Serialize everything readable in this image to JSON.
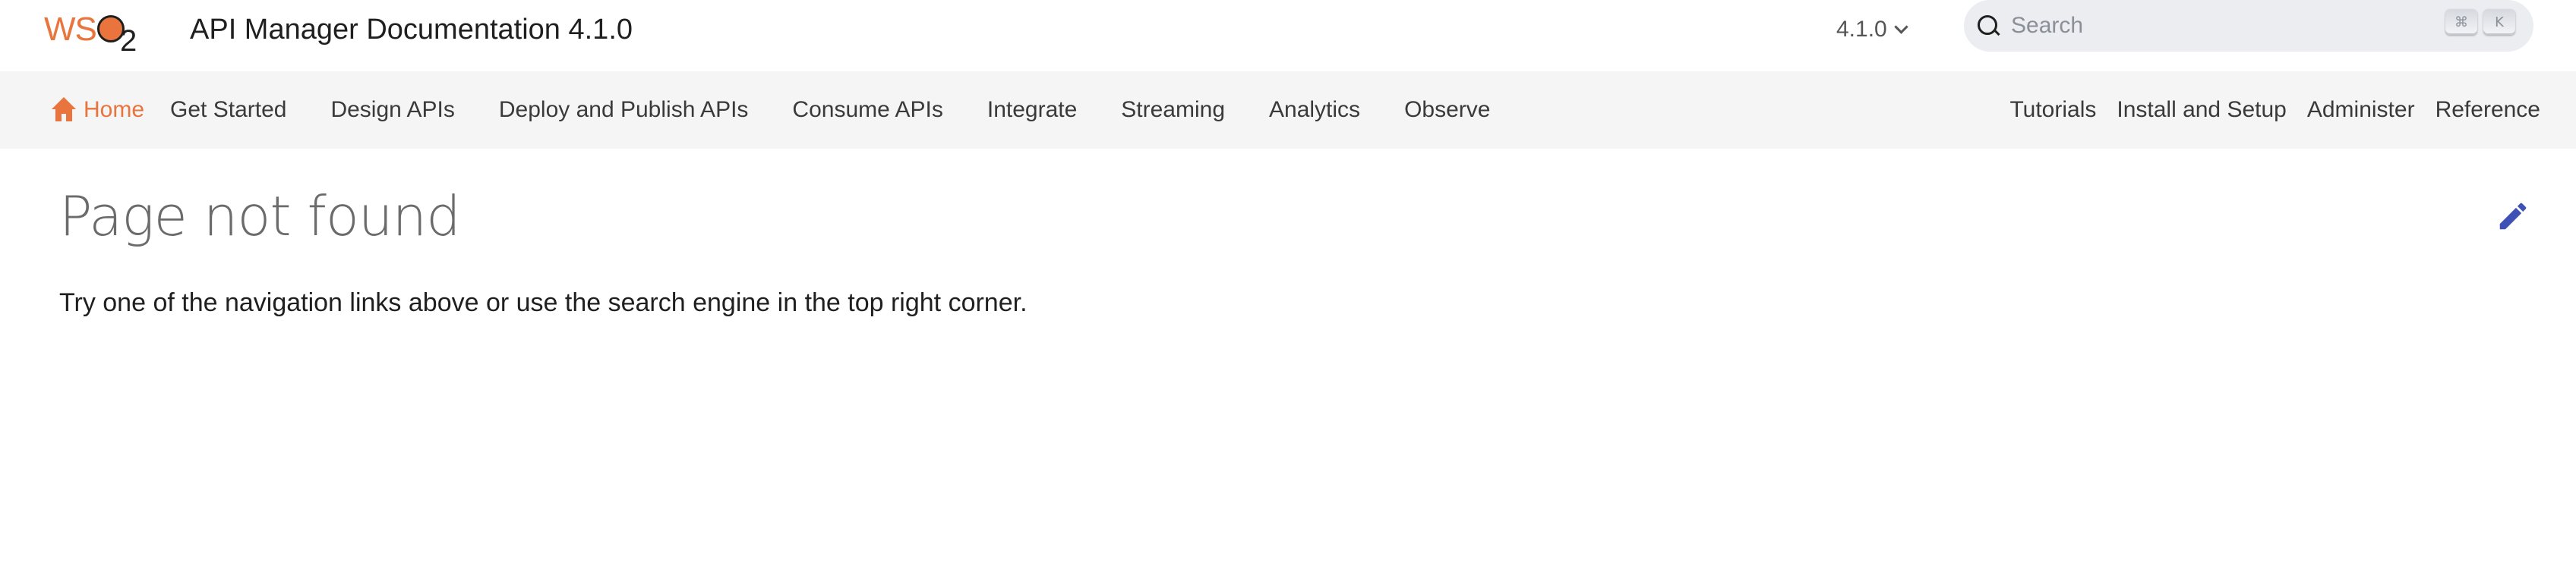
{
  "header": {
    "logo_text": "WSO",
    "logo_sub": "2",
    "title": "API Manager Documentation 4.1.0",
    "version": "4.1.0",
    "search": {
      "placeholder": "Search",
      "shortcut_keys": [
        "⌘",
        "K"
      ]
    }
  },
  "nav": {
    "home_label": "Home",
    "left_items": [
      "Get Started",
      "Design APIs",
      "Deploy and Publish APIs",
      "Consume APIs",
      "Integrate",
      "Streaming",
      "Analytics",
      "Observe"
    ],
    "right_items": [
      "Tutorials",
      "Install and Setup",
      "Administer",
      "Reference"
    ]
  },
  "main": {
    "title": "Page not found",
    "message": "Try one of the navigation links above or use the search engine in the top right corner."
  },
  "icons": {
    "search": "search-icon",
    "home": "home-icon",
    "edit": "pencil-icon",
    "version_chevron": "chevron-down-icon"
  },
  "colors": {
    "brand_orange": "#e9743d",
    "edit_icon": "#3f51b5",
    "nav_background": "#f5f5f5",
    "search_background": "#ebedf0"
  }
}
